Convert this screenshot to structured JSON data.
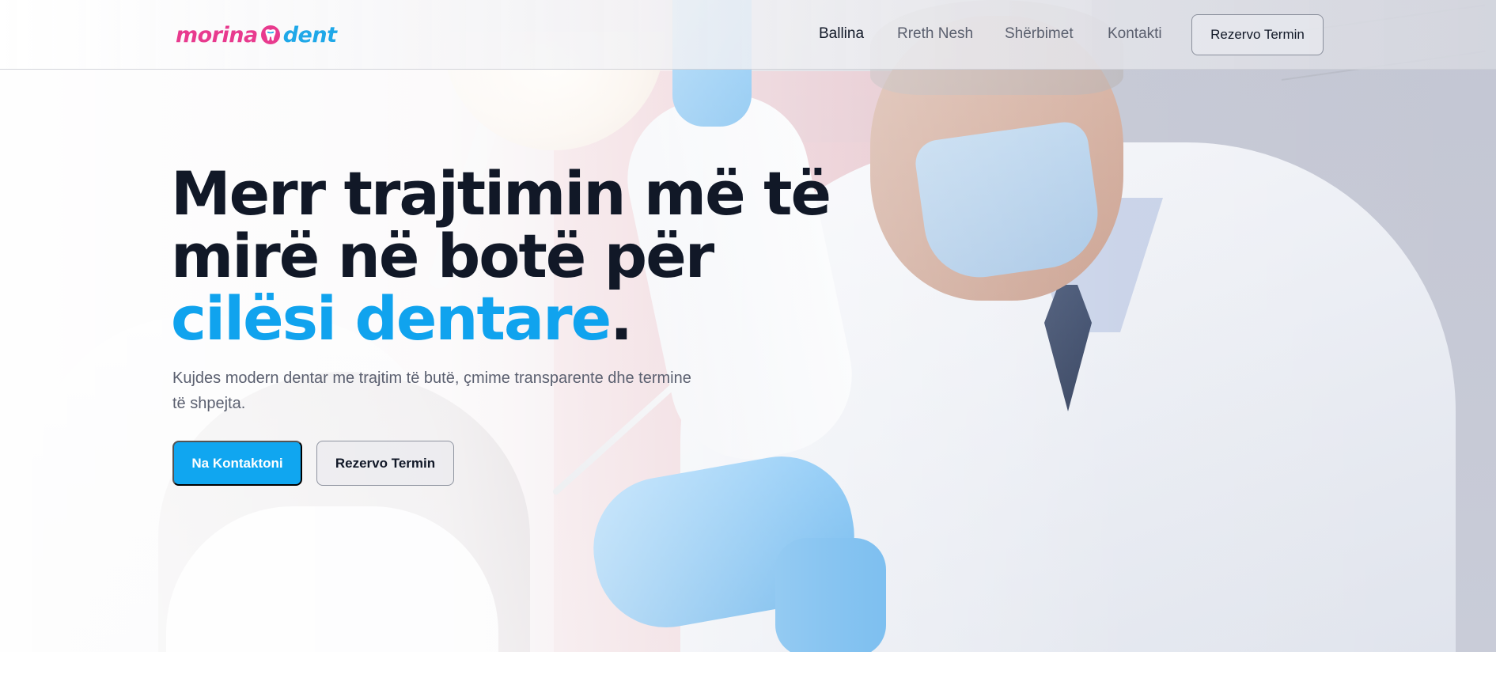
{
  "brand": {
    "logo_part1": "morina",
    "logo_part2": "dent",
    "pink": "#e83a8e",
    "blue": "#1fa8e8",
    "logo_icon": "tooth-icon"
  },
  "nav": {
    "items": [
      {
        "label": "Ballina",
        "active": true
      },
      {
        "label": "Rreth Nesh",
        "active": false
      },
      {
        "label": "Shërbimet",
        "active": false
      },
      {
        "label": "Kontakti",
        "active": false
      }
    ],
    "cta_label": "Rezervo Termin"
  },
  "hero": {
    "headline_line1": "Merr trajtimin më të",
    "headline_line2": "mirë në botë për",
    "headline_accent": "cilësi dentare",
    "headline_end": ".",
    "subtitle": "Kujdes modern dentar me trajtim të butë, çmime transparente dhe termine të shpejta.",
    "primary_button": "Na Kontaktoni",
    "secondary_button": "Rezervo Termin",
    "accent_color": "#10a3ee",
    "text_color": "#111827"
  }
}
